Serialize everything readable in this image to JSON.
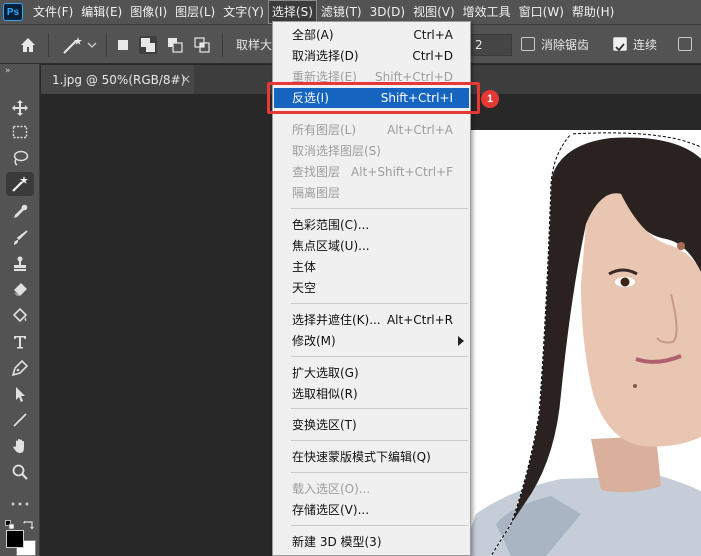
{
  "app": {
    "logo": "Ps"
  },
  "menubar": {
    "items": [
      "文件(F)",
      "编辑(E)",
      "图像(I)",
      "图层(L)",
      "文字(Y)",
      "选择(S)",
      "滤镜(T)",
      "3D(D)",
      "视图(V)",
      "增效工具",
      "窗口(W)",
      "帮助(H)"
    ],
    "active_index": 5
  },
  "options_bar": {
    "sample_label": "取样大",
    "tolerance_value": "2",
    "antialias_label": "消除锯齿",
    "antialias_checked": false,
    "contiguous_label": "连续",
    "contiguous_checked": true
  },
  "toolbox": {
    "tools": [
      "move-icon",
      "marquee-icon",
      "lasso-icon",
      "magic-wand-icon",
      "eyedropper-icon",
      "brush-icon",
      "stamp-icon",
      "eraser-icon",
      "pen-icon",
      "text-icon",
      "path-selection-icon",
      "hand-icon",
      "line-icon",
      "zoom-icon"
    ],
    "active_tool": "magic-wand-icon",
    "foreground_color": "#000000",
    "background_color": "#ffffff"
  },
  "document_tab": {
    "title": "1.jpg @ 50%(RGB/8#)",
    "close_glyph": "×"
  },
  "select_menu": {
    "groups": [
      [
        {
          "label": "全部(A)",
          "shortcut": "Ctrl+A",
          "enabled": true
        },
        {
          "label": "取消选择(D)",
          "shortcut": "Ctrl+D",
          "enabled": true
        },
        {
          "label": "重新选择(E)",
          "shortcut": "Shift+Ctrl+D",
          "enabled": false
        },
        {
          "label": "反选(I)",
          "shortcut": "Shift+Ctrl+I",
          "enabled": true,
          "highlighted": true
        }
      ],
      [
        {
          "label": "所有图层(L)",
          "shortcut": "Alt+Ctrl+A",
          "enabled": false
        },
        {
          "label": "取消选择图层(S)",
          "shortcut": "",
          "enabled": false
        },
        {
          "label": "查找图层",
          "shortcut": "Alt+Shift+Ctrl+F",
          "enabled": false
        },
        {
          "label": "隔离图层",
          "shortcut": "",
          "enabled": false
        }
      ],
      [
        {
          "label": "色彩范围(C)...",
          "shortcut": "",
          "enabled": true
        },
        {
          "label": "焦点区域(U)...",
          "shortcut": "",
          "enabled": true
        },
        {
          "label": "主体",
          "shortcut": "",
          "enabled": true
        },
        {
          "label": "天空",
          "shortcut": "",
          "enabled": true
        }
      ],
      [
        {
          "label": "选择并遮住(K)...",
          "shortcut": "Alt+Ctrl+R",
          "enabled": true
        },
        {
          "label": "修改(M)",
          "shortcut": "",
          "enabled": true,
          "submenu": true
        }
      ],
      [
        {
          "label": "扩大选取(G)",
          "shortcut": "",
          "enabled": true
        },
        {
          "label": "选取相似(R)",
          "shortcut": "",
          "enabled": true
        }
      ],
      [
        {
          "label": "变换选区(T)",
          "shortcut": "",
          "enabled": true
        }
      ],
      [
        {
          "label": "在快速蒙版模式下编辑(Q)",
          "shortcut": "",
          "enabled": true
        }
      ],
      [
        {
          "label": "载入选区(O)...",
          "shortcut": "",
          "enabled": false
        },
        {
          "label": "存储选区(V)...",
          "shortcut": "",
          "enabled": true
        }
      ],
      [
        {
          "label": "新建 3D 模型(3)",
          "shortcut": "",
          "enabled": true
        }
      ]
    ]
  },
  "annotation": {
    "badge": "1",
    "color": "#e53935"
  },
  "colors": {
    "menu_highlight": "#1565c0",
    "panel": "#535353",
    "canvas": "#282828"
  }
}
